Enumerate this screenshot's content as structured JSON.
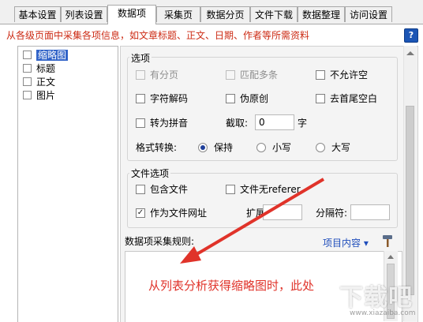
{
  "tabs": [
    {
      "label": "基本设置",
      "active": false
    },
    {
      "label": "列表设置",
      "active": false
    },
    {
      "label": "数据项",
      "active": true
    },
    {
      "label": "采集页",
      "active": false
    },
    {
      "label": "数据分页",
      "active": false
    },
    {
      "label": "文件下载",
      "active": false
    },
    {
      "label": "数据整理",
      "active": false
    },
    {
      "label": "访问设置",
      "active": false
    }
  ],
  "subtitle": "从各级页面中采集各项信息，如文章标题、正文、日期、作者等所需资料",
  "help_label": "?",
  "item_list": [
    {
      "label": "缩略图",
      "checked": false,
      "selected": true
    },
    {
      "label": "标题",
      "checked": false,
      "selected": false
    },
    {
      "label": "正文",
      "checked": false,
      "selected": false
    },
    {
      "label": "图片",
      "checked": false,
      "selected": false
    }
  ],
  "options": {
    "legend": "选项",
    "paged": {
      "label": "有分页",
      "checked": false,
      "disabled": true
    },
    "match_multi": {
      "label": "匹配多条",
      "checked": false,
      "disabled": true
    },
    "no_empty": {
      "label": "不允许空",
      "checked": false
    },
    "char_decode": {
      "label": "字符解码",
      "checked": false
    },
    "fake_original": {
      "label": "伪原创",
      "checked": false
    },
    "trim_blank": {
      "label": "去首尾空白",
      "checked": false
    },
    "to_pinyin": {
      "label": "转为拼音",
      "checked": false
    },
    "truncate_label": "截取:",
    "truncate_value": "0",
    "truncate_unit": "字",
    "format_label": "格式转换:",
    "format_options": [
      {
        "label": "保持",
        "selected": true
      },
      {
        "label": "小写",
        "selected": false
      },
      {
        "label": "大写",
        "selected": false
      }
    ]
  },
  "file_options": {
    "legend": "文件选项",
    "include_file": {
      "label": "包含文件",
      "checked": false
    },
    "file_no_referer": {
      "label": "文件无referer",
      "checked": false
    },
    "as_file_url": {
      "label": "作为文件网址",
      "checked": true
    },
    "ext_label": "扩展名:",
    "ext_value": "",
    "sep_label": "分隔符:",
    "sep_value": ""
  },
  "rule": {
    "label": "数据项采集规则:",
    "dropdown_label": "项目内容",
    "annotation": "从列表分析获得缩略图时，此处"
  },
  "watermark": {
    "text": "下载吧",
    "url": "www.xiazaiba.com"
  },
  "colors": {
    "annotation": "#e0332a",
    "subtitle": "#cc2b14",
    "selection": "#3264c8",
    "link": "#1e4dbb"
  }
}
